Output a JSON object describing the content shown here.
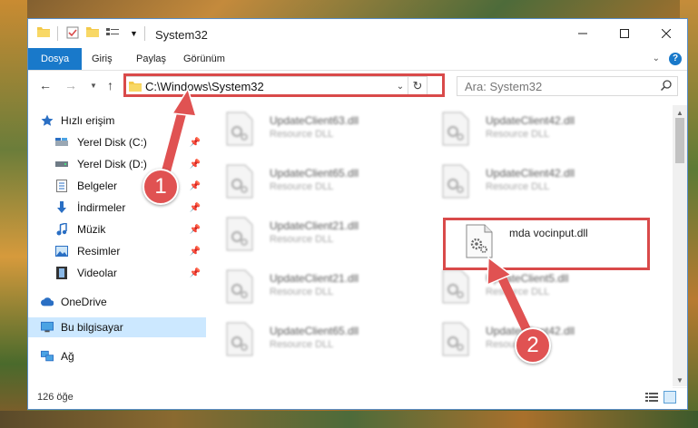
{
  "window": {
    "title": "System32"
  },
  "ribbon": {
    "tabs": [
      "Dosya",
      "Giriş",
      "Paylaş",
      "Görünüm"
    ]
  },
  "address": {
    "path": "C:\\Windows\\System32"
  },
  "search": {
    "placeholder": "Ara: System32"
  },
  "sidebar": {
    "quick_access": "Hızlı erişim",
    "items": [
      {
        "label": "Yerel Disk (C:)",
        "icon": "drive-icon"
      },
      {
        "label": "Yerel Disk (D:)",
        "icon": "drive-icon"
      },
      {
        "label": "Belgeler",
        "icon": "documents-icon"
      },
      {
        "label": "İndirmeler",
        "icon": "download-icon"
      },
      {
        "label": "Müzik",
        "icon": "music-icon"
      },
      {
        "label": "Resimler",
        "icon": "pictures-icon"
      },
      {
        "label": "Videolar",
        "icon": "videos-icon"
      }
    ],
    "onedrive": "OneDrive",
    "this_pc": "Bu bilgisayar",
    "network": "Ağ"
  },
  "files": [
    {
      "name": "UpdateClient63.dll",
      "desc": "Resource DLL"
    },
    {
      "name": "UpdateClient42.dll",
      "desc": "Resource DLL"
    },
    {
      "name": "UpdateClient65.dll",
      "desc": "Resource DLL"
    },
    {
      "name": "UpdateClient42.dll",
      "desc": "Resource DLL"
    },
    {
      "name": "UpdateClient21.dll",
      "desc": "Resource DLL"
    },
    {
      "name": "mda vocinput.dll",
      "desc": ""
    },
    {
      "name": "UpdateClient21.dll",
      "desc": "Resource DLL"
    },
    {
      "name": "UpdateClient5.dll",
      "desc": "Resource DLL"
    },
    {
      "name": "UpdateClient65.dll",
      "desc": "Resource DLL"
    },
    {
      "name": "UpdateClient42.dll",
      "desc": "Resource DLL"
    }
  ],
  "status": {
    "count": "126 öğe"
  },
  "callouts": {
    "one": "1",
    "two": "2"
  },
  "colors": {
    "accent": "#1979ca",
    "highlight": "#d94a4a",
    "selected": "#cce8ff"
  }
}
